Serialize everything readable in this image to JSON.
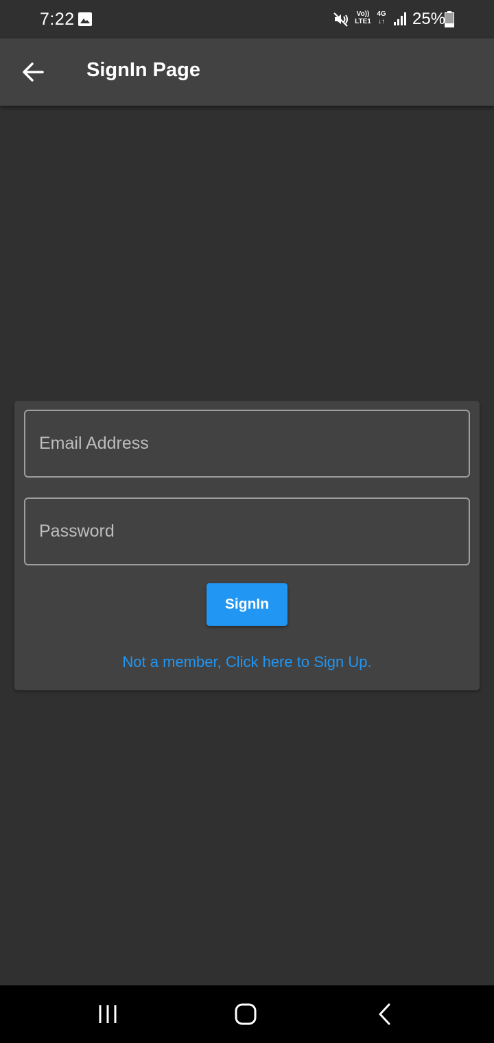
{
  "status_bar": {
    "time": "7:22",
    "volte_top": "Vo))",
    "volte_bottom": "LTE1",
    "network_type": "4G",
    "network_arrows": "↓↑",
    "battery_percent": "25%",
    "battery_level": 0.25,
    "icons": [
      "gallery-icon",
      "mute-icon",
      "signal-icon",
      "battery-icon"
    ]
  },
  "app_bar": {
    "title": "SignIn Page",
    "back_icon": "arrow-left-icon"
  },
  "signin_form": {
    "email_placeholder": "Email Address",
    "email_value": "",
    "password_placeholder": "Password",
    "password_value": "",
    "signin_label": "SignIn",
    "signup_link": "Not a member, Click here to Sign Up."
  },
  "nav_bar": {
    "icons": [
      "recents-icon",
      "home-icon",
      "back-icon"
    ]
  },
  "colors": {
    "background": "#303030",
    "app_bar": "#424242",
    "card": "#424242",
    "accent": "#2196f3",
    "nav_bar": "#000000"
  }
}
